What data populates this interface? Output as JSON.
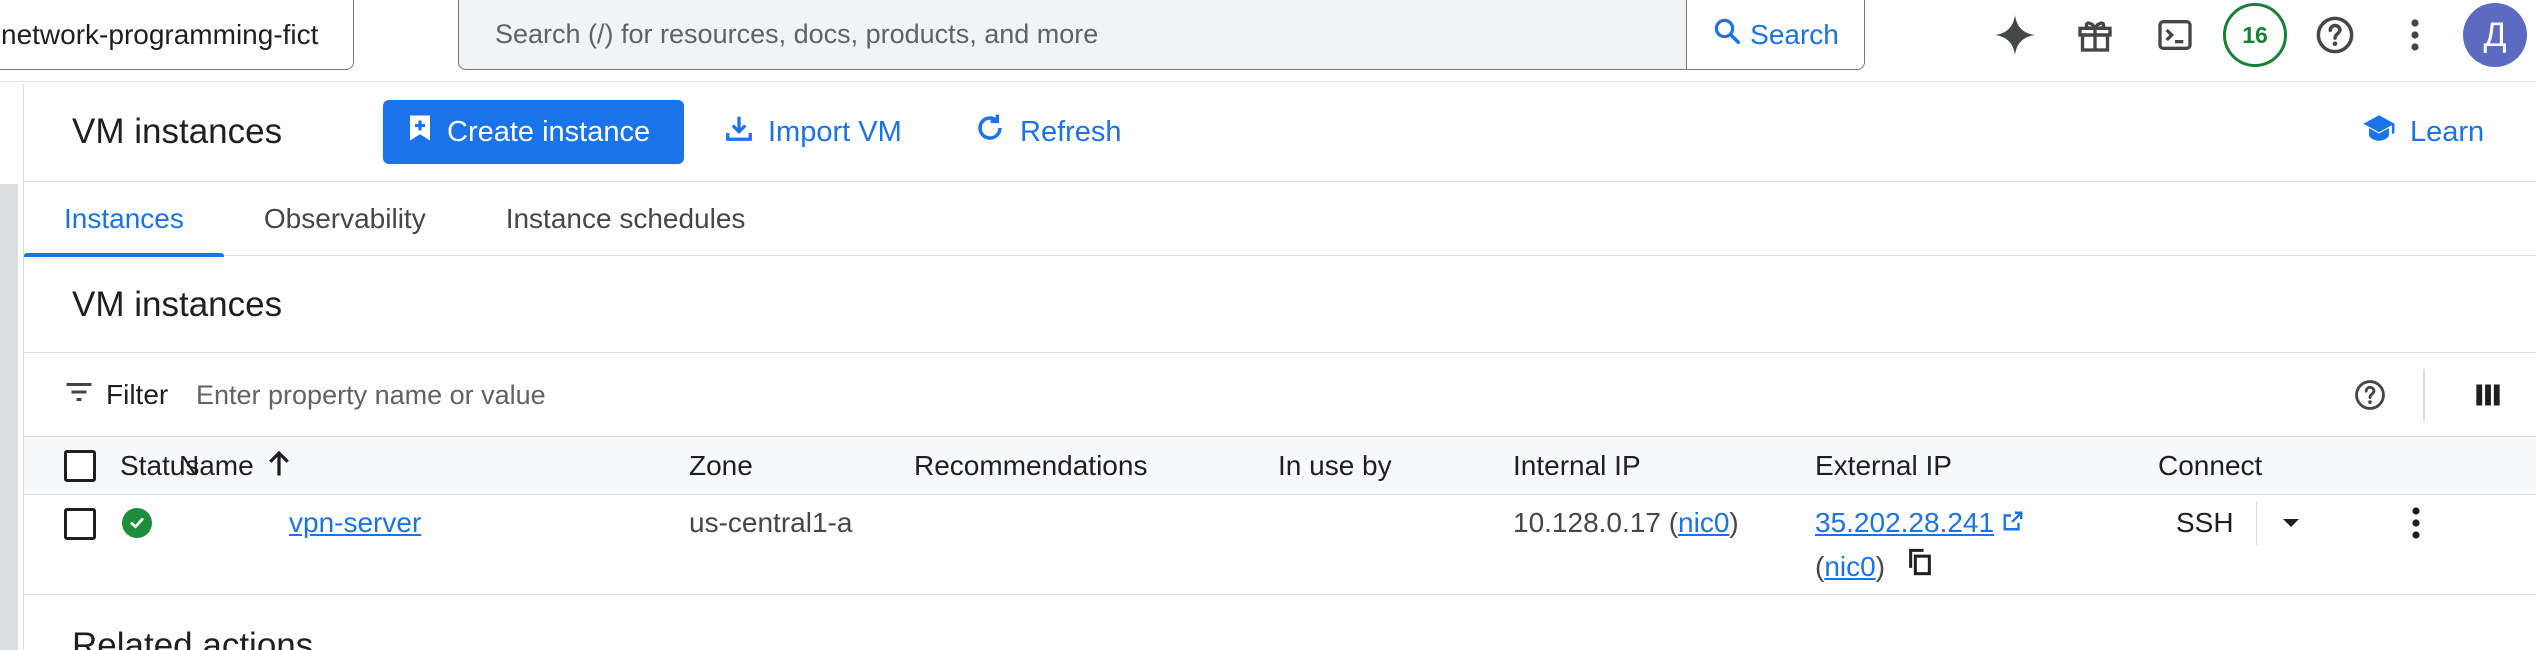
{
  "topbar": {
    "project_name": "network-programming-fict",
    "search_placeholder": "Search (/) for resources, docs, products, and more",
    "search_button": "Search",
    "notifications_count": "16",
    "avatar_letter": "Д"
  },
  "actions": {
    "page_title": "VM instances",
    "create_instance": "Create instance",
    "import_vm": "Import VM",
    "refresh": "Refresh",
    "learn": "Learn"
  },
  "tabs": [
    {
      "label": "Instances",
      "active": true
    },
    {
      "label": "Observability",
      "active": false
    },
    {
      "label": "Instance schedules",
      "active": false
    }
  ],
  "section_title": "VM instances",
  "filter": {
    "label": "Filter",
    "placeholder": "Enter property name or value"
  },
  "table": {
    "headers": {
      "status": "Status",
      "name": "Name",
      "zone": "Zone",
      "recommendations": "Recommendations",
      "in_use_by": "In use by",
      "internal_ip": "Internal IP",
      "external_ip": "External IP",
      "connect": "Connect"
    },
    "rows": [
      {
        "status": "running",
        "name": "vpn-server",
        "zone": "us-central1-a",
        "internal_ip": "10.128.0.17",
        "internal_nic": "nic0",
        "external_ip": "35.202.28.241",
        "external_nic": "nic0",
        "connect": "SSH"
      }
    ]
  },
  "related_actions": "Related actions",
  "colors": {
    "accent": "#1a73e8",
    "status_ok": "#1e8e3e",
    "badge": "#188038",
    "avatar": "#5c6bc0"
  }
}
